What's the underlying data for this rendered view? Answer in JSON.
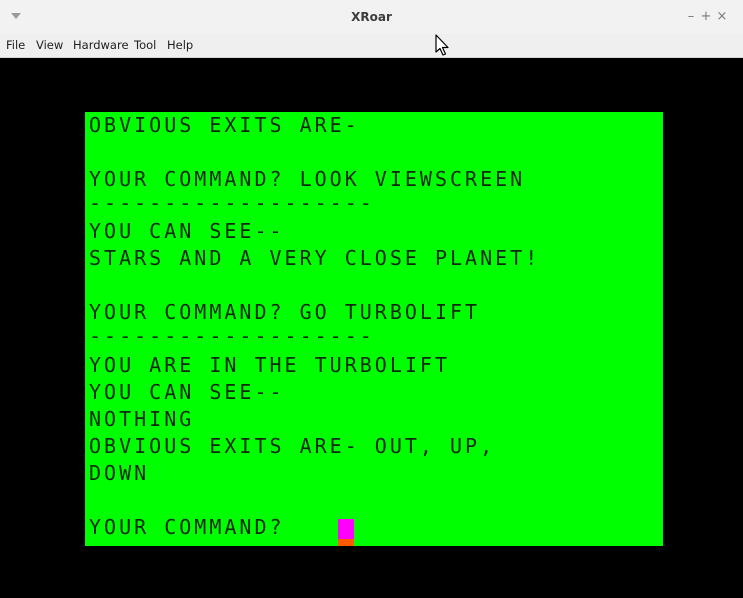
{
  "window": {
    "title": "XRoar",
    "controls": {
      "minimize": "–",
      "maximize": "+",
      "close": "×"
    }
  },
  "menubar": {
    "items": [
      "File",
      "View",
      "Hardware",
      "Tool",
      "Help"
    ]
  },
  "screen": {
    "background_color": "#00ff00",
    "text_color": "#0a2a0a",
    "cursor_color": "#ff00ff",
    "lines": [
      "OBVIOUS EXITS ARE-",
      "",
      "YOUR COMMAND? LOOK VIEWSCREEN",
      "-------------------",
      "YOU CAN SEE--",
      "STARS AND A VERY CLOSE PLANET!",
      "",
      "YOUR COMMAND? GO TURBOLIFT",
      "-------------------",
      "YOU ARE IN THE TURBOLIFT",
      "YOU CAN SEE--",
      "NOTHING",
      "OBVIOUS EXITS ARE- OUT, UP,",
      "DOWN",
      "",
      "YOUR COMMAND? "
    ]
  }
}
